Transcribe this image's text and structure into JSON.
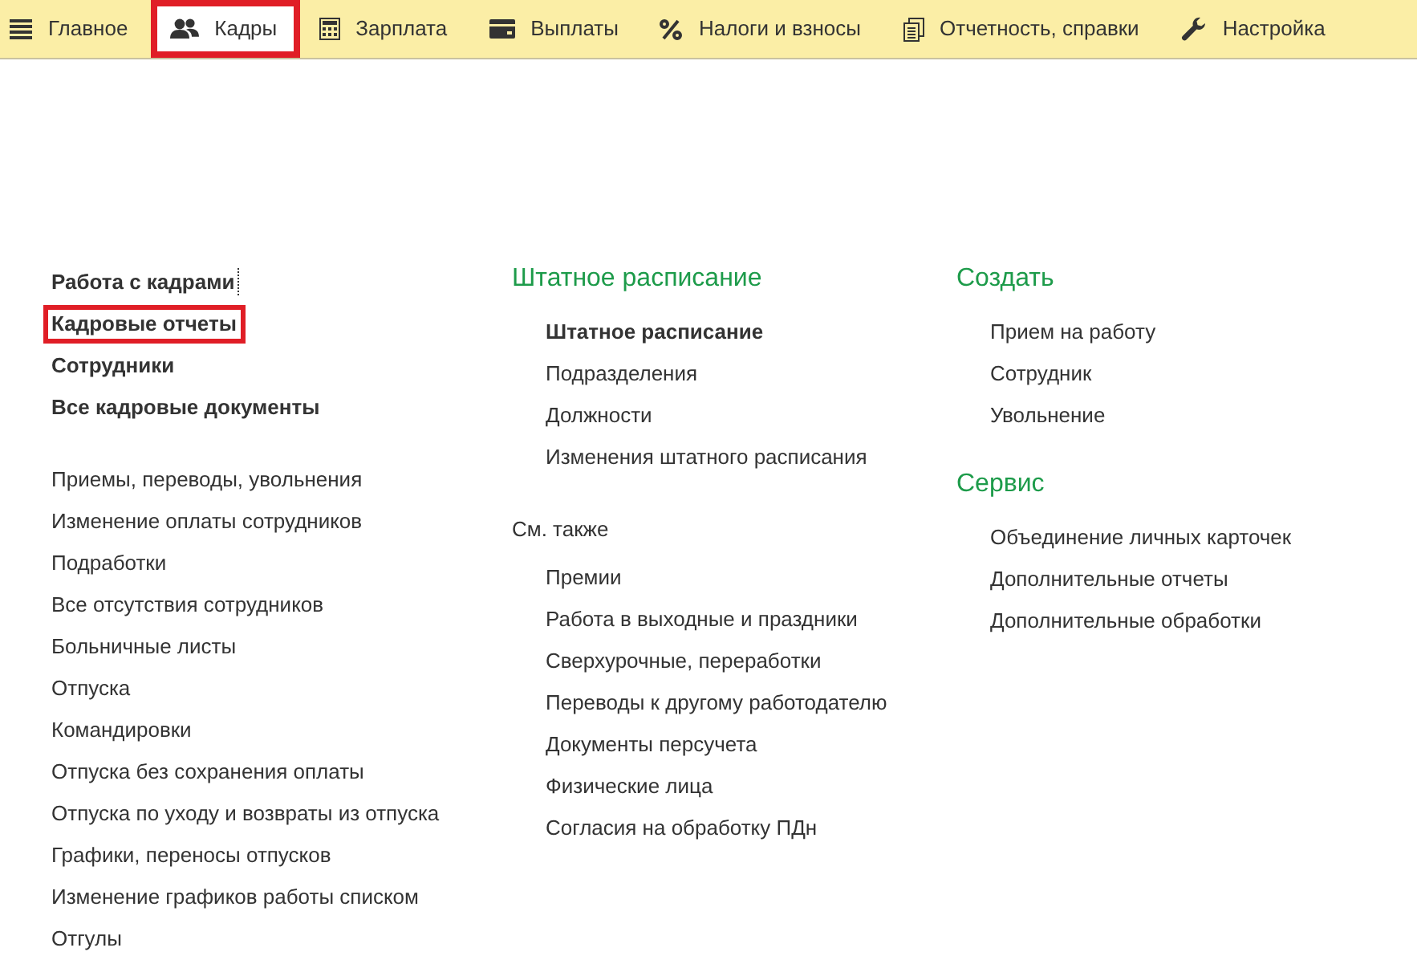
{
  "menu": {
    "items": [
      {
        "label": "Главное",
        "selected": false,
        "highlighted": false
      },
      {
        "label": "Кадры",
        "selected": true,
        "highlighted": true
      },
      {
        "label": "Зарплата",
        "selected": false,
        "highlighted": false
      },
      {
        "label": "Выплаты",
        "selected": false,
        "highlighted": false
      },
      {
        "label": "Налоги и взносы",
        "selected": false,
        "highlighted": false
      },
      {
        "label": "Отчетность, справки",
        "selected": false,
        "highlighted": false
      },
      {
        "label": "Настройка",
        "selected": false,
        "highlighted": false
      }
    ]
  },
  "columns": [
    {
      "sections": [
        {
          "items": [
            {
              "label": "Работа с кадрами",
              "bold": true,
              "highlighted": false,
              "focused": true
            },
            {
              "label": "Кадровые отчеты",
              "bold": true,
              "highlighted": true,
              "focused": false
            },
            {
              "label": "Сотрудники",
              "bold": true,
              "highlighted": false,
              "focused": false
            },
            {
              "label": "Все кадровые документы",
              "bold": true,
              "highlighted": false,
              "focused": false
            }
          ]
        },
        {
          "items": [
            {
              "label": "Приемы, переводы, увольнения",
              "bold": false,
              "highlighted": false,
              "focused": false
            },
            {
              "label": "Изменение оплаты сотрудников",
              "bold": false,
              "highlighted": false,
              "focused": false
            },
            {
              "label": "Подработки",
              "bold": false,
              "highlighted": false,
              "focused": false
            },
            {
              "label": "Все отсутствия сотрудников",
              "bold": false,
              "highlighted": false,
              "focused": false
            },
            {
              "label": "Больничные листы",
              "bold": false,
              "highlighted": false,
              "focused": false
            },
            {
              "label": "Отпуска",
              "bold": false,
              "highlighted": false,
              "focused": false
            },
            {
              "label": "Командировки",
              "bold": false,
              "highlighted": false,
              "focused": false
            },
            {
              "label": "Отпуска без сохранения оплаты",
              "bold": false,
              "highlighted": false,
              "focused": false
            },
            {
              "label": "Отпуска по уходу и возвраты из отпуска",
              "bold": false,
              "highlighted": false,
              "focused": false
            },
            {
              "label": "Графики, переносы отпусков",
              "bold": false,
              "highlighted": false,
              "focused": false
            },
            {
              "label": "Изменение графиков работы списком",
              "bold": false,
              "highlighted": false,
              "focused": false
            },
            {
              "label": "Отгулы",
              "bold": false,
              "highlighted": false,
              "focused": false
            }
          ]
        }
      ]
    },
    {
      "sections": [
        {
          "title": "Штатное расписание",
          "kind": "group",
          "items": [
            {
              "label": "Штатное расписание",
              "bold": true,
              "highlighted": false,
              "focused": false
            },
            {
              "label": "Подразделения",
              "bold": false,
              "highlighted": false,
              "focused": false
            },
            {
              "label": "Должности",
              "bold": false,
              "highlighted": false,
              "focused": false
            },
            {
              "label": "Изменения штатного расписания",
              "bold": false,
              "highlighted": false,
              "focused": false
            }
          ]
        },
        {
          "title": "См. также",
          "kind": "aside",
          "items": [
            {
              "label": "Премии",
              "bold": false,
              "highlighted": false,
              "focused": false
            },
            {
              "label": "Работа в выходные и праздники",
              "bold": false,
              "highlighted": false,
              "focused": false
            },
            {
              "label": "Сверхурочные, переработки",
              "bold": false,
              "highlighted": false,
              "focused": false
            },
            {
              "label": "Переводы к другому работодателю",
              "bold": false,
              "highlighted": false,
              "focused": false
            },
            {
              "label": "Документы персучета",
              "bold": false,
              "highlighted": false,
              "focused": false
            },
            {
              "label": "Физические лица",
              "bold": false,
              "highlighted": false,
              "focused": false
            },
            {
              "label": "Согласия на обработку ПДн",
              "bold": false,
              "highlighted": false,
              "focused": false
            }
          ]
        }
      ]
    },
    {
      "sections": [
        {
          "title": "Создать",
          "kind": "group",
          "items": [
            {
              "label": "Прием на работу",
              "bold": false,
              "highlighted": false,
              "focused": false
            },
            {
              "label": "Сотрудник",
              "bold": false,
              "highlighted": false,
              "focused": false
            },
            {
              "label": "Увольнение",
              "bold": false,
              "highlighted": false,
              "focused": false
            }
          ]
        },
        {
          "title": "Сервис",
          "kind": "group",
          "items": [
            {
              "label": "Объединение личных карточек",
              "bold": false,
              "highlighted": false,
              "focused": false
            },
            {
              "label": "Дополнительные отчеты",
              "bold": false,
              "highlighted": false,
              "focused": false
            },
            {
              "label": "Дополнительные обработки",
              "bold": false,
              "highlighted": false,
              "focused": false
            }
          ]
        }
      ]
    }
  ]
}
